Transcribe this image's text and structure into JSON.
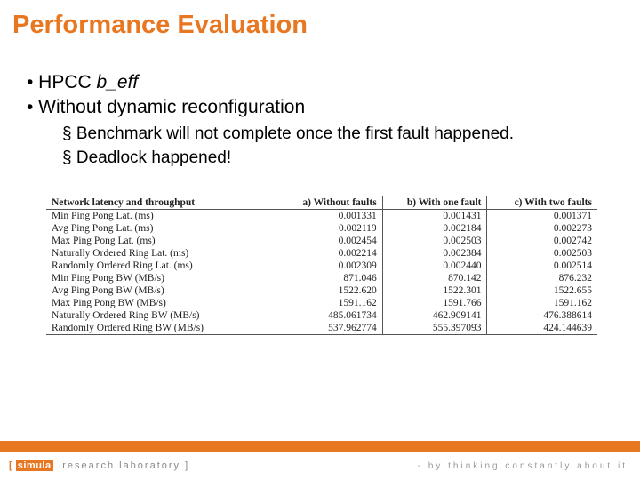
{
  "slide": {
    "title": "Performance Evaluation",
    "bullets_l1": [
      {
        "prefix": "• HPCC ",
        "italic": "b_eff",
        "suffix": ""
      },
      {
        "prefix": "• Without dynamic reconfiguration",
        "italic": "",
        "suffix": ""
      }
    ],
    "bullets_l2": [
      "§ Benchmark will not complete once the first fault happened.",
      "§ Deadlock happened!"
    ]
  },
  "table": {
    "headers": {
      "metric": "Network latency and throughput",
      "a": "a) Without faults",
      "b": "b) With one fault",
      "c": "c) With two faults"
    },
    "rows": [
      {
        "metric": "Min Ping Pong Lat. (ms)",
        "a": "0.001331",
        "b": "0.001431",
        "c": "0.001371"
      },
      {
        "metric": "Avg Ping Pong Lat. (ms)",
        "a": "0.002119",
        "b": "0.002184",
        "c": "0.002273"
      },
      {
        "metric": "Max Ping Pong Lat. (ms)",
        "a": "0.002454",
        "b": "0.002503",
        "c": "0.002742"
      },
      {
        "metric": "Naturally Ordered Ring Lat. (ms)",
        "a": "0.002214",
        "b": "0.002384",
        "c": "0.002503"
      },
      {
        "metric": "Randomly Ordered Ring Lat. (ms)",
        "a": "0.002309",
        "b": "0.002440",
        "c": "0.002514"
      },
      {
        "metric": "Min Ping Pong BW (MB/s)",
        "a": "871.046",
        "b": "870.142",
        "c": "876.232"
      },
      {
        "metric": "Avg Ping Pong BW (MB/s)",
        "a": "1522.620",
        "b": "1522.301",
        "c": "1522.655"
      },
      {
        "metric": "Max Ping Pong BW (MB/s)",
        "a": "1591.162",
        "b": "1591.766",
        "c": "1591.162"
      },
      {
        "metric": "Naturally Ordered Ring BW (MB/s)",
        "a": "485.061734",
        "b": "462.909141",
        "c": "476.388614"
      },
      {
        "metric": "Randomly Ordered Ring BW (MB/s)",
        "a": "537.962774",
        "b": "555.397093",
        "c": "424.144639"
      }
    ]
  },
  "footer": {
    "logo_bracket_l": "[ ",
    "logo_brand": "simula",
    "logo_dot": " . ",
    "logo_rest": "research laboratory ]",
    "tagline": "- by thinking constantly about it"
  }
}
